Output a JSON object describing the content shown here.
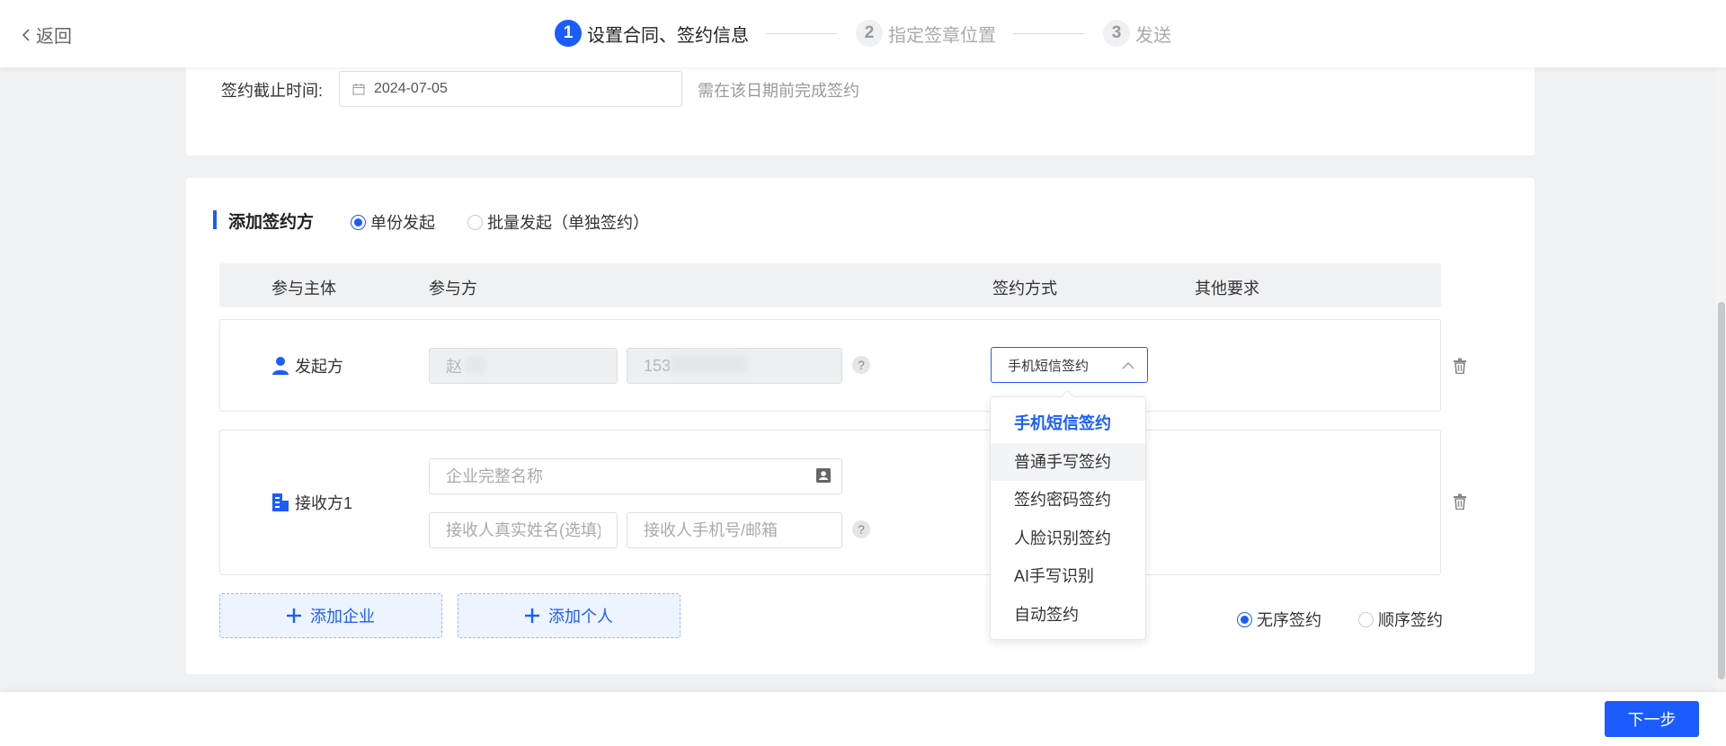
{
  "header": {
    "back_label": "返回",
    "steps": [
      {
        "num": "1",
        "label": "设置合同、签约信息"
      },
      {
        "num": "2",
        "label": "指定签章位置"
      },
      {
        "num": "3",
        "label": "发送"
      }
    ]
  },
  "deadline": {
    "label": "签约截止时间:",
    "value": "2024-07-05",
    "hint": "需在该日期前完成签约"
  },
  "signers": {
    "title": "添加签约方",
    "mode_options": [
      "单份发起",
      "批量发起（单独签约）"
    ],
    "mode_selected": "单份发起",
    "columns": [
      "参与主体",
      "参与方",
      "签约方式",
      "其他要求"
    ],
    "initiator": {
      "role": "发起方",
      "name_value": "赵",
      "phone_value": "153",
      "sign_method": "手机短信签约"
    },
    "receiver": {
      "role": "接收方1",
      "company_placeholder": "企业完整名称",
      "name_placeholder": "接收人真实姓名(选填)",
      "contact_placeholder": "接收人手机号/邮箱"
    },
    "sign_method_options": [
      "手机短信签约",
      "普通手写签约",
      "签约密码签约",
      "人脸识别签约",
      "AI手写识别",
      "自动签约"
    ],
    "add_company_label": "添加企业",
    "add_person_label": "添加个人",
    "order_options": [
      "无序签约",
      "顺序签约"
    ],
    "order_selected": "无序签约"
  },
  "footer": {
    "next_label": "下一步"
  },
  "colors": {
    "accent": "#1a5cff"
  }
}
